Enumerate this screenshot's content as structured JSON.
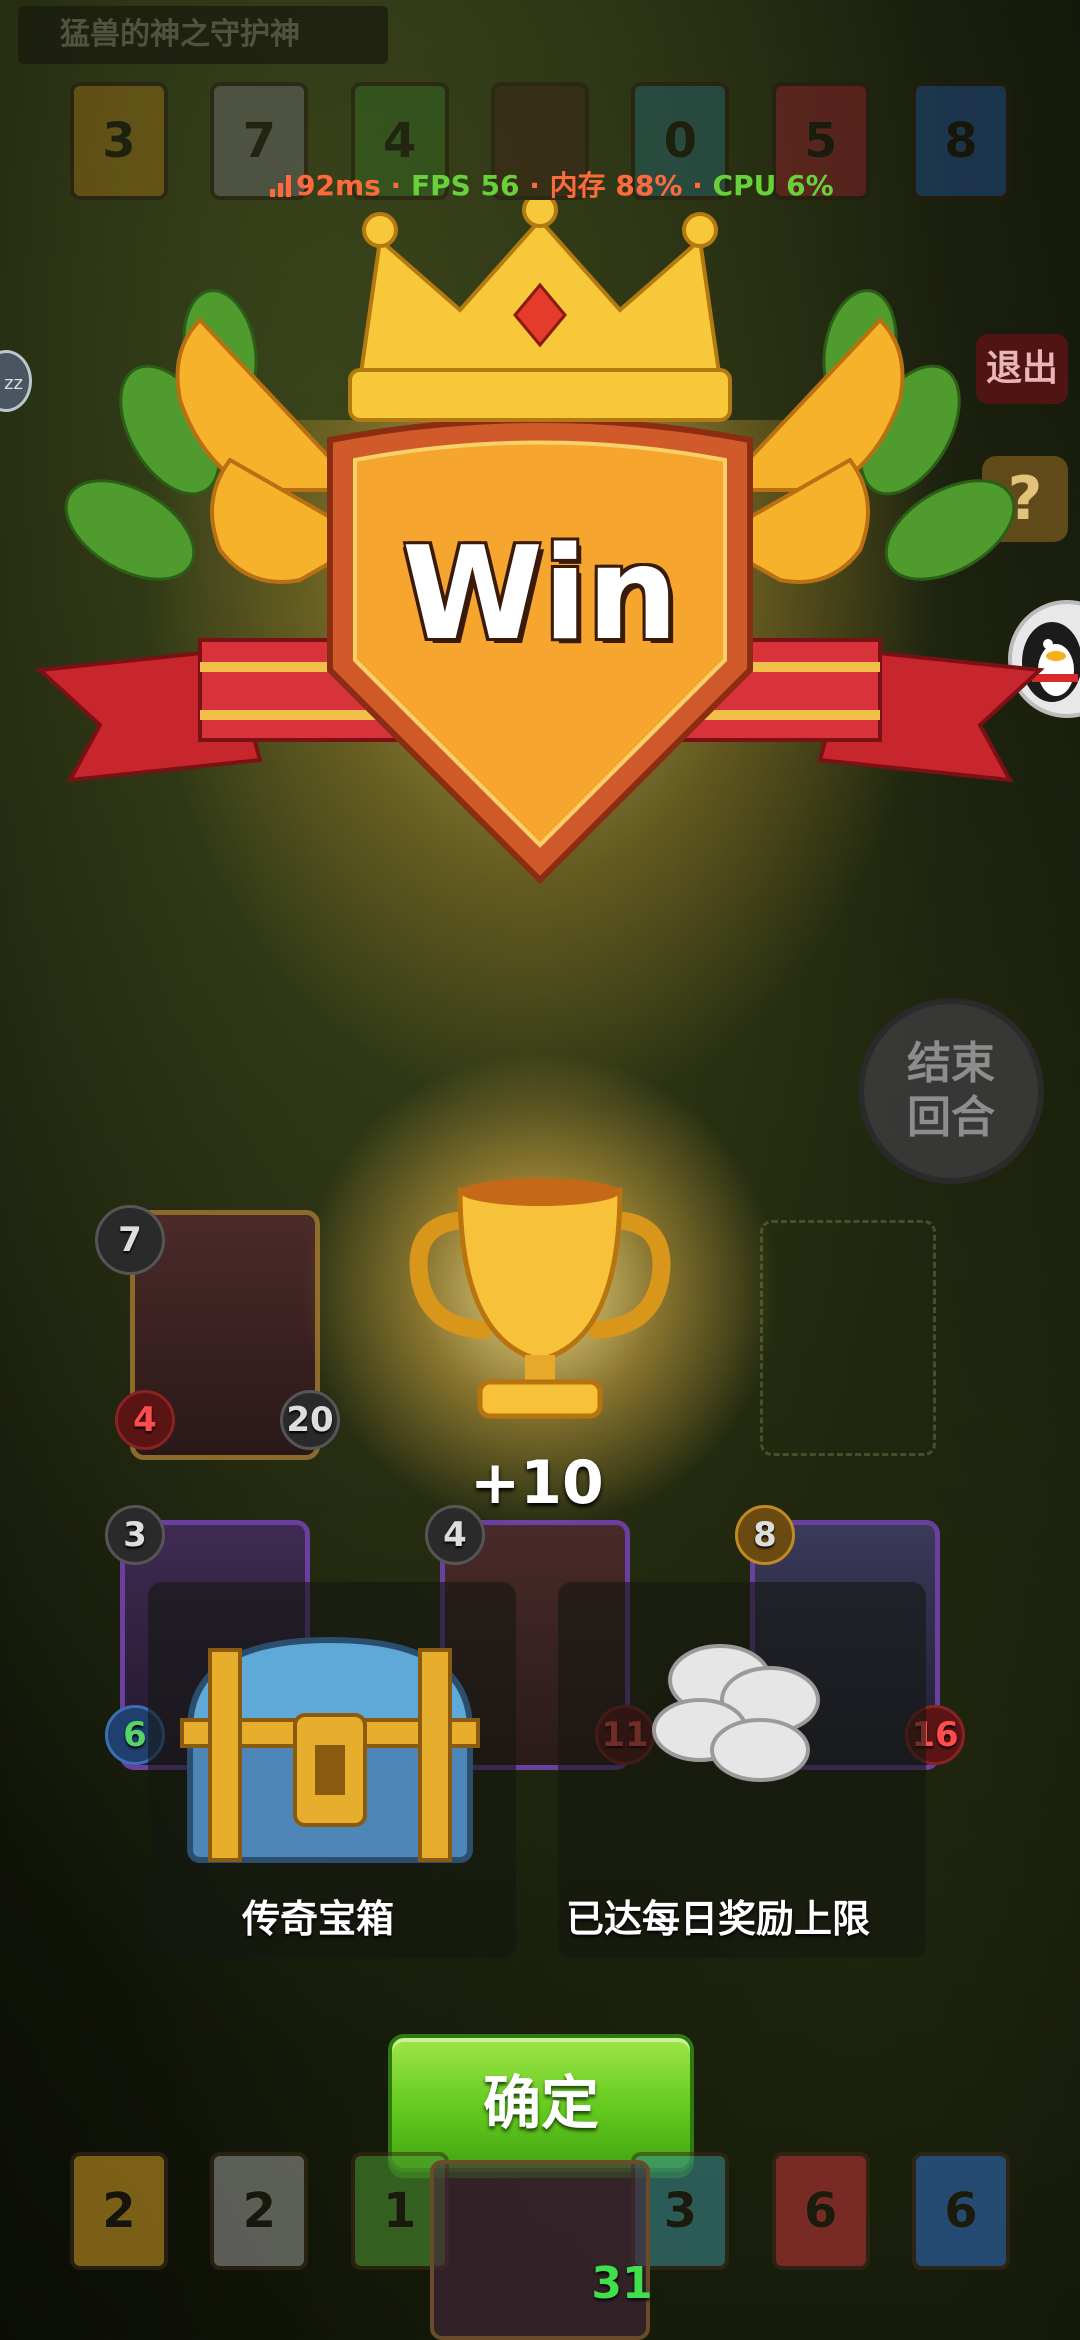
{
  "title": "猛兽的神之守护神",
  "top_cards": [
    "3",
    "7",
    "4",
    "",
    "0",
    "5",
    "8"
  ],
  "perf": {
    "ping": "92ms",
    "sep1": " · ",
    "fps": "FPS 56",
    "sep2": " · ",
    "mem": "内存 88%",
    "sep3": " · ",
    "cpu": "CPU 6%"
  },
  "buttons": {
    "exit": "退出",
    "help": "?",
    "end_turn_line1": "结束",
    "end_turn_line2": "回合",
    "confirm": "确定"
  },
  "left_badge": "zz",
  "win_text": "Win",
  "reward_points": "+10",
  "field_cards": [
    {
      "cost": "7",
      "attack": "4",
      "health": "20"
    },
    {
      "cost": "3",
      "attack": "6",
      "health": ""
    },
    {
      "cost": "4",
      "attack": "",
      "health": "11"
    },
    {
      "cost": "8",
      "attack": "",
      "health": "16"
    }
  ],
  "rewards": [
    {
      "label": "传奇宝箱",
      "icon": "treasure-chest-icon"
    },
    {
      "label": "已达每日奖励上限",
      "icon": "silver-coins-icon"
    }
  ],
  "bottom_cards": [
    "2",
    "2",
    "1",
    "",
    "3",
    "6",
    "6"
  ],
  "hero_health": "31",
  "colors": {
    "confirm": "#63c91e",
    "gold": "#f2b632",
    "ribbon": "#c8262d"
  }
}
